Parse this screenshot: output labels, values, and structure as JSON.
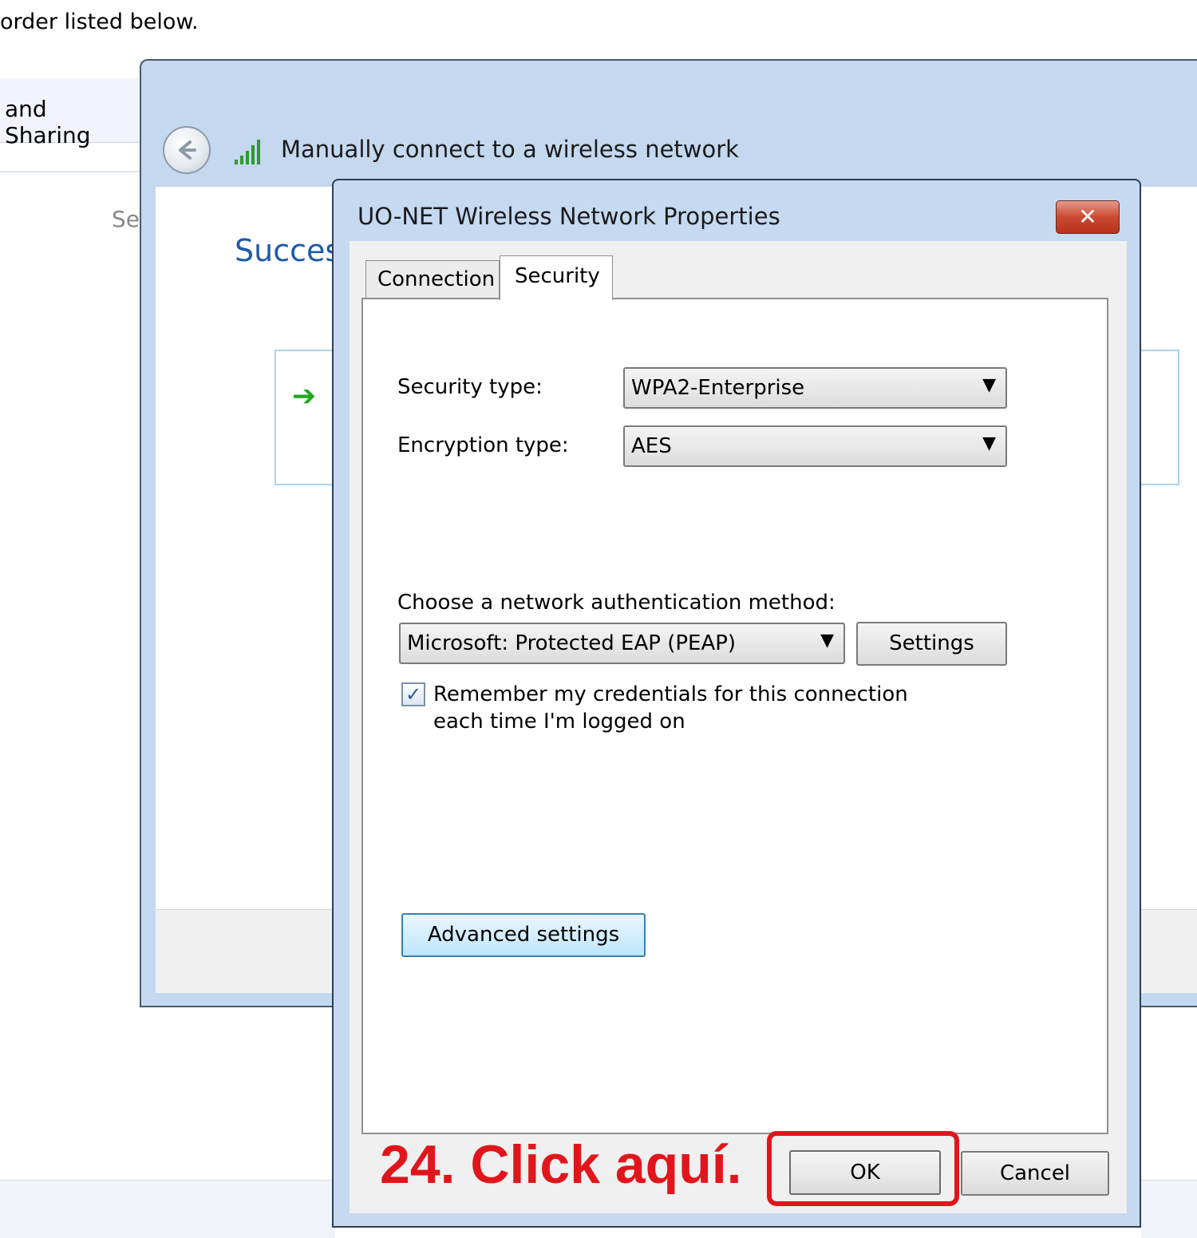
{
  "page": {
    "top_text": "order listed below."
  },
  "background_window": {
    "title": "and Sharing",
    "partial_text": "Se"
  },
  "wizard": {
    "title": "Manually connect to a wireless network",
    "heading": "Succes",
    "back_icon": "back-arrow-icon",
    "signal_icon": "wireless-signal-icon",
    "command_icon": "green-arrow-icon"
  },
  "dialog": {
    "title": "UO-NET Wireless Network Properties",
    "close_icon": "close-icon",
    "tabs": [
      {
        "label": "Connection",
        "selected": false
      },
      {
        "label": "Security",
        "selected": true
      }
    ],
    "security_type": {
      "label": "Security type:",
      "value": "WPA2-Enterprise"
    },
    "encryption_type": {
      "label": "Encryption type:",
      "value": "AES"
    },
    "auth": {
      "label": "Choose a network authentication method:",
      "value": "Microsoft: Protected EAP (PEAP)",
      "settings_label": "Settings"
    },
    "remember": {
      "checked": true,
      "label": "Remember my credentials for this connection each time I'm logged on"
    },
    "advanced_label": "Advanced settings",
    "ok_label": "OK",
    "cancel_label": "Cancel"
  },
  "annotation": {
    "text": "24. Click aquí.",
    "color": "#e0161c"
  },
  "colors": {
    "dialog_frame": "#c5d9f1",
    "heading_blue": "#1e5aa8",
    "close_red": "#cc4a32"
  }
}
